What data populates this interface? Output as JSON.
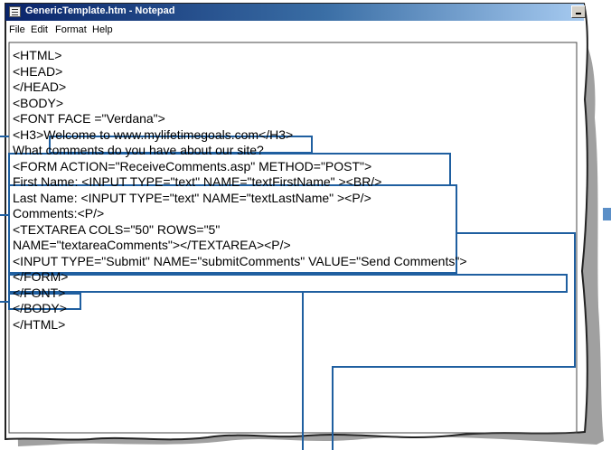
{
  "window": {
    "title": "GenericTemplate.htm - Notepad",
    "title_icon": "notepad-icon"
  },
  "menu": [
    "File",
    "Edit",
    "Format",
    "Help"
  ],
  "code_lines": [
    "<HTML>",
    "<HEAD>",
    "</HEAD>",
    "<BODY>",
    "<FONT FACE =\"Verdana\">",
    "<H3>Welcome to www.mylifetimegoals.com</H3>",
    "What comments do you have about our site?",
    "<FORM ACTION=\"ReceiveComments.asp\" METHOD=\"POST\">",
    "First Name: <INPUT TYPE=\"text\" NAME=\"textFirstName\" ><BR/>",
    "Last Name: <INPUT TYPE=\"text\" NAME=\"textLastName\" ><P/>",
    "Comments:<P/>",
    "<TEXTAREA COLS=\"50\" ROWS=\"5\"",
    "NAME=\"textareaComments\"></TEXTAREA><P/>",
    "<INPUT TYPE=\"Submit\" NAME=\"submitComments\" VALUE=\"Send Comments\">",
    "</FORM>",
    "</FONT>",
    "</BODY>",
    "</HTML>"
  ],
  "colors": {
    "callout": "#1f5fa0",
    "paper_edge": "#222222",
    "shadow": "#9a9a9a",
    "titlebar_start": "#0a246a",
    "titlebar_end": "#a6caf0"
  }
}
